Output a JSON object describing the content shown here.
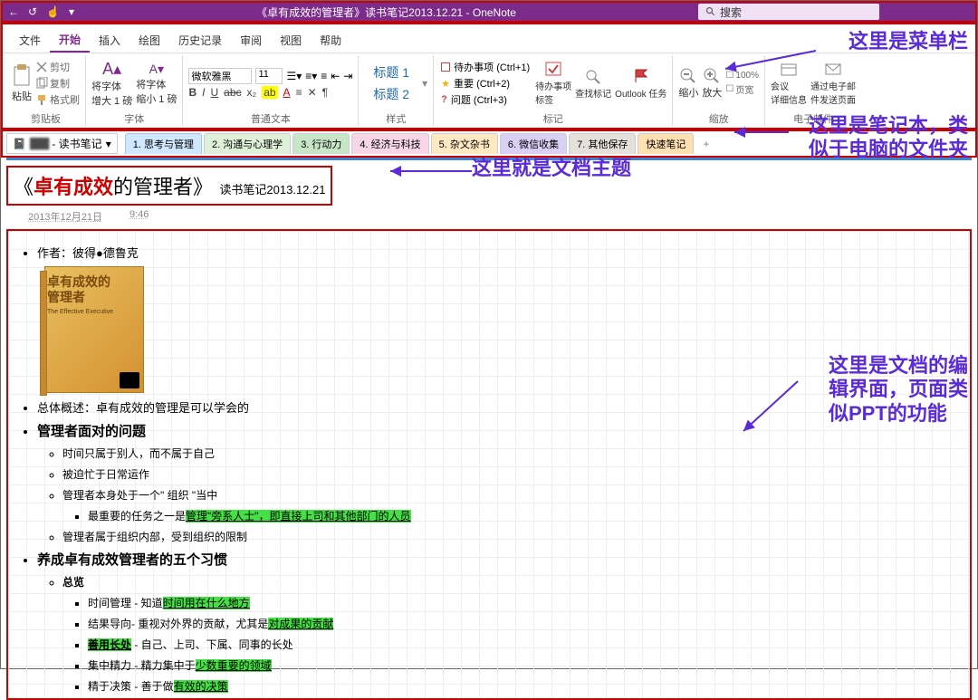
{
  "titlebar": {
    "doc_title": "《卓有成效的管理者》读书笔记2013.12.21  -  OneNote",
    "search_placeholder": "搜索"
  },
  "menu": {
    "tabs": [
      "文件",
      "开始",
      "插入",
      "绘图",
      "历史记录",
      "审阅",
      "视图",
      "帮助"
    ],
    "active": 1
  },
  "ribbon": {
    "clipboard": {
      "paste": "粘贴",
      "cut": "剪切",
      "copy": "复制",
      "format": "格式刷",
      "label": "剪贴板"
    },
    "font": {
      "enlarge": "将字体\n增大 1 磅",
      "shrink": "将字体\n缩小 1 磅",
      "font_name": "微软雅黑",
      "font_size": "11",
      "label": "字体"
    },
    "basic_text_label": "普通文本",
    "styles": {
      "h1": "标题 1",
      "h2": "标题 2",
      "label": "样式"
    },
    "tags": {
      "todo": "待办事项 (Ctrl+1)",
      "important": "重要 (Ctrl+2)",
      "question": "问题 (Ctrl+3)",
      "todo_btn": "待办事项\n标签",
      "find": "查找标记",
      "outlook": "Outlook 任务",
      "label": "标记"
    },
    "zoom": {
      "out": "缩小",
      "in": "放大",
      "pct": "100%",
      "pagewidth": "页宽",
      "label": "缩放"
    },
    "email": {
      "meeting": "会议\n详细信息",
      "send": "通过电子邮\n件发送页面",
      "label": "电子邮件"
    }
  },
  "notebook": {
    "name": "- 读书笔记",
    "sections": [
      "1. 思考与管理",
      "2. 沟通与心理学",
      "3. 行动力",
      "4. 经济与科技",
      "5. 杂文杂书",
      "6. 微信收集",
      "7. 其他保存",
      "快速笔记"
    ]
  },
  "page": {
    "title_red": "卓有成效",
    "title_rest": "的管理者",
    "title_suffix": "读书笔记2013.12.21",
    "date": "2013年12月21日",
    "time": "9:46"
  },
  "content": {
    "author": "作者：彼得●德鲁克",
    "book_cover_title": "卓有成效的\n管理者",
    "book_cover_en": "The Effective Executive",
    "summary": "总体概述：卓有成效的管理是可以学会的",
    "h1": "管理者面对的问题",
    "h1_items": [
      "时间只属于别人，而不属于自己",
      "被迫忙于日常运作",
      "管理者本身处于一个\" 组织 \"当中",
      "管理者属于组织内部，受到组织的限制"
    ],
    "h1_sub": "最重要的任务之一是",
    "h1_sub_hl": "管理\"旁系人士\"，即直接上司和其他部门的人员",
    "h2": "养成卓有成效管理者的五个习惯",
    "h2_overview": "总览",
    "h2_items": [
      {
        "pre": "时间管理 - 知道",
        "hl": "时间用在什么地方"
      },
      {
        "pre": "结果导向- 重视对外界的贡献，尤其是",
        "hl": "对成果的贡献"
      },
      {
        "pre": "",
        "hl": "善用长处",
        "post": " - 自己、上司、下属、同事的长处",
        "preBold": true
      },
      {
        "pre": "集中精力 - 精力集中于",
        "hl": "少数重要的领域"
      },
      {
        "pre": "精于决策 - 善于做",
        "hl": "有效的决策"
      }
    ]
  },
  "annotations": {
    "a1": "这里是菜单栏",
    "a2": "这里是笔记本，类\n似于电脑的文件夹",
    "a3": "这里就是文档主题",
    "a4": "这里是文档的编\n辑界面，页面类\n似PPT的功能"
  }
}
